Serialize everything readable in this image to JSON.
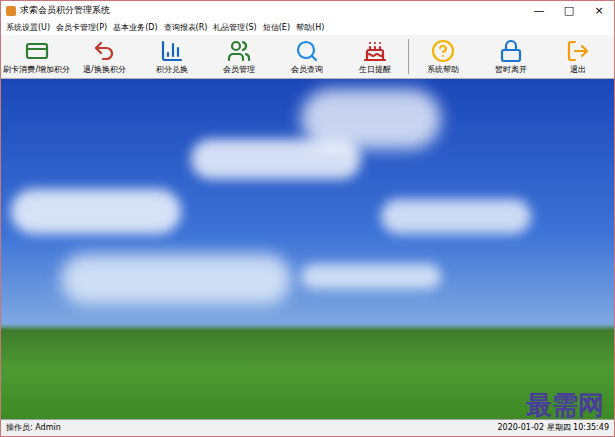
{
  "window": {
    "title": "求索会员积分管理系统",
    "controls": [
      "—",
      "□",
      "×"
    ]
  },
  "menu": [
    "系统设置(U)",
    "会员卡管理(P)",
    "基本业务(D)",
    "查询报表(R)",
    "礼品管理(S)",
    "短信(E)",
    "帮助(H)"
  ],
  "toolbar": {
    "groups": [
      [
        "刷卡消费/增加积分",
        "退/换换积分",
        "积分兑换",
        "会员管理",
        "会员查询",
        "生日提醒"
      ],
      [
        "系统帮助",
        "暂时离开",
        "退出"
      ]
    ]
  },
  "status_bar": {
    "operator": "操作员: Admin",
    "datetime": "2020-01-02 星期四 10:35:49"
  },
  "watermark": "最需网"
}
